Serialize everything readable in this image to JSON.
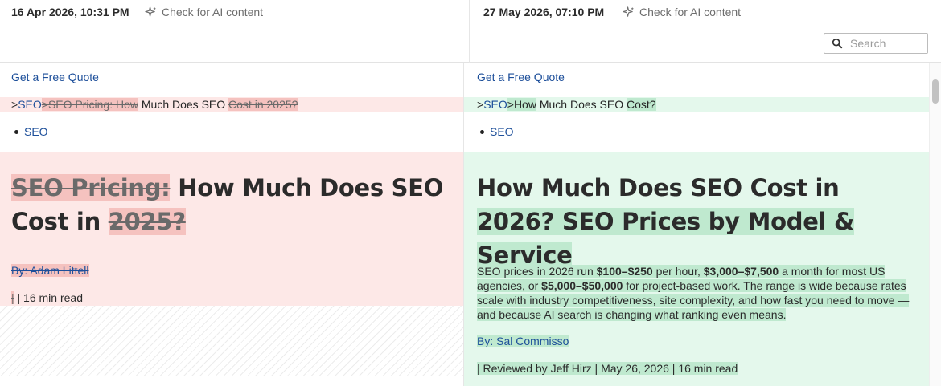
{
  "left": {
    "timestamp": "16 Apr 2026, 10:31 PM",
    "ai_check_label": "Check for AI content",
    "quote_link": "Get a Free Quote",
    "crumb_gt1": ">",
    "crumb_seo": "SEO",
    "crumb_removed1": ">SEO Pricing: How",
    "crumb_common": " Much Does SEO ",
    "crumb_removed2": "Cost in 2025?",
    "bullet_link": "SEO",
    "title_removed1": "SEO Pricing:",
    "title_common": " How Much Does SEO Cost in ",
    "title_removed2": "2025?",
    "byline": "By: Adam Littell",
    "meta_removed": "|",
    "meta_rest": " | 16 min read"
  },
  "right": {
    "timestamp": "27 May 2026, 07:10 PM",
    "ai_check_label": "Check for AI content",
    "search_placeholder": "Search",
    "quote_link": "Get a Free Quote",
    "crumb_gt1": ">",
    "crumb_seo": "SEO",
    "crumb_added1": ">How",
    "crumb_common": " Much Does SEO ",
    "crumb_added2": "Cost?",
    "bullet_link": "SEO",
    "title_common": "How Much Does SEO Cost in ",
    "title_added": "2026? SEO Prices by Model & Service",
    "intro_1": "SEO prices in 2026 run ",
    "intro_b1": "$100–$250",
    "intro_2": " per hour, ",
    "intro_b2": "$3,000–$7,500",
    "intro_3": " a month for most US agencies, or ",
    "intro_b3": "$5,000–$50,000",
    "intro_4": " for project-based work. The range is wide because rates scale with industry competitiveness, site complexity, and how fast you need to move — and because AI search is changing what ranking even means.",
    "byline": "By: Sal Commisso",
    "meta": "| Reviewed by Jeff Hirz | May 26, 2026 | 16 min read"
  }
}
